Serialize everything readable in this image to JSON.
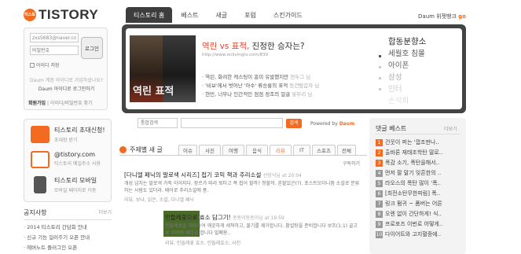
{
  "logo": {
    "badge": "티스토리",
    "word": "TISTORY"
  },
  "topnav": {
    "tabs": [
      "티스토리 홈",
      "베스트",
      "새글",
      "포럼",
      "스킨가이드"
    ]
  },
  "daum_link": {
    "label": "Daum 위젯뱅크",
    "go": "go"
  },
  "login": {
    "id_value": "zxs5683@naver.cor",
    "pw_placeholder": "비밀번호",
    "button": "로그인",
    "remember": "아이디 저장",
    "question": "Daum 계정 아이디로 가입하셨나요?",
    "daum_login": "Daum 아이디로 로그인하기",
    "signup": "회원가입",
    "find": "아이디/비밀번호 찾기"
  },
  "feature": {
    "title_red": "역린 vs 표적,",
    "title_rest": " 진정한 승자는?",
    "url": "http://www.onlivingtv.com/839",
    "items": [
      {
        "text": "역린, 화려한 캐스팅이 흥미 유발했지만",
        "src": "연두그 님"
      },
      {
        "text": "'비보'에서 벗어난 '아수' 류승룡의 표적",
        "src": "동건탐갑자 님"
      },
      {
        "text": "현빈, 너무나 인간적인 점점 정조의 얼굴",
        "src": "빛무리 님"
      }
    ],
    "side": [
      "합동분향소",
      "세월호 침몰",
      "아이폰",
      "삼성",
      "인터",
      "손석희"
    ],
    "poster_text": "역린 표적"
  },
  "promo": [
    {
      "title": "티스토리 초대신청!",
      "sub": "초대장 받기"
    },
    {
      "title": "@tistory.com",
      "sub": "티스토리 메일주소 사용"
    },
    {
      "title": "티스토리 모바일",
      "sub": "모바일 페이지로 이동"
    }
  ],
  "notice": {
    "title": "공지사항",
    "more": "더보기",
    "items": [
      "2014 티스토리 간담회 안내",
      "신규 기능 일러주기 오픈 안내",
      "에버노트 플러그인 오픈"
    ]
  },
  "search": {
    "select": "통합검색",
    "button": "검색",
    "powered": "Powered by",
    "brand": "Daum"
  },
  "section": {
    "title": "주제별 새 글",
    "tabs": [
      "이슈",
      "사진",
      "여행",
      "음식",
      "리뷰",
      "IT",
      "스포츠",
      "전체"
    ],
    "active_tab": "리뷰",
    "subscribe": "구독하기"
  },
  "articles": [
    {
      "title": "[다니엘 페닉의 말로색 시리즈] 접기 코믹 책과 추리소설",
      "meta": "선망식님 at 20:04",
      "desc": "개성 넘치는 말로색 가죽 이어지다. 장르가 따라 퇴타고 폭 접어 할까? 청할까. 흔할있곤(?). 포스트모더니즘 소설로 분류하는 사람도 있더라. 떼어로 추리소설에 풍.",
      "tags": "리뷰, 보냐, 읽은, 소설, 다니엘 페닉"
    },
    {
      "title": "민들레꽃으로 효소 담그기!",
      "meta": "동동이동동이님 at 19:59",
      "desc": "민들레꽃을 채취하여 깨끗하게 세척하고, 물기를 제거합니다. 황설탕을 준비합니다 보조(1:1) 골고루 치며며 배합을 합니다 밀폐용..",
      "tags": "리뷰, 민들레꽃 효소, 민들레효소, 사진"
    }
  ],
  "ranking": {
    "title": "댓글 베스트",
    "more": "더보기",
    "items": [
      "건웃이 퍼는 '껍조판나..",
      "출바론 재태조학탄 말로..",
      "폭감 소기, 폭탄을해서..",
      "먼저 팔 말기 잊흔한의 ..",
      "라오스의 폭탄 많이 '폭..",
      "[최전소탄무한피림] 폭..",
      "링크 펌귀 ~ 폼버는 어른",
      "오렌 없이 간단하게! 식..",
      "프로포즈 이번로 어떻게..",
      "다이어트와 고지혈증에.."
    ]
  }
}
